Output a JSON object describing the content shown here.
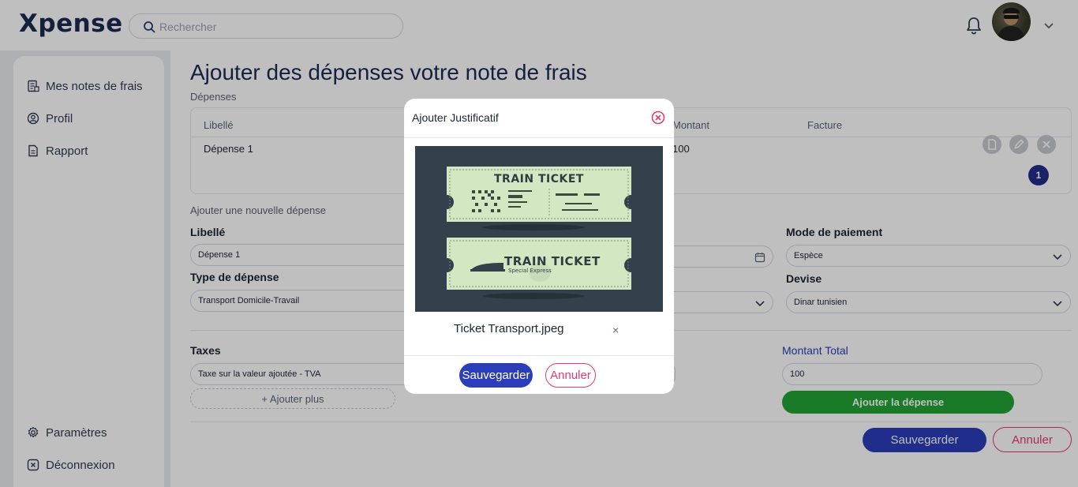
{
  "header": {
    "logo": "Xpense",
    "search_placeholder": "Rechercher"
  },
  "sidebar": {
    "items": [
      {
        "label": "Mes notes de frais",
        "icon": "expense-report-icon"
      },
      {
        "label": "Profil",
        "icon": "user-icon"
      },
      {
        "label": "Rapport",
        "icon": "document-icon"
      }
    ],
    "bottom_items": [
      {
        "label": "Paramètres",
        "icon": "gear-icon"
      },
      {
        "label": "Déconnexion",
        "icon": "logout-icon"
      }
    ]
  },
  "main": {
    "title": "Ajouter des dépenses votre note de frais",
    "section_expenses": "Dépenses",
    "table": {
      "columns": [
        "Libellé",
        "Montant",
        "Facture"
      ],
      "rows": [
        {
          "libelle": "Dépense 1",
          "montant": "100"
        }
      ],
      "page": "1"
    },
    "section_new": "Ajouter une nouvelle dépense",
    "form": {
      "libelle_label": "Libellé",
      "libelle_value": "Dépense 1",
      "type_label": "Type de dépense",
      "type_value": "Transport Domicile-Travail",
      "payment_label": "Mode de paiement",
      "payment_value": "Espèce",
      "currency_label": "Devise",
      "currency_value": "Dinar tunisien",
      "taxes_label": "Taxes",
      "tax_value": "Taxe sur la valeur ajoutée - TVA",
      "add_more": "+ Ajouter plus",
      "total_label": "Montant Total",
      "total_value": "100",
      "add_expense": "Ajouter la dépense"
    },
    "footer": {
      "save": "Sauvegarder",
      "cancel": "Annuler"
    }
  },
  "modal": {
    "title": "Ajouter Justificatif",
    "ticket_title_1": "TRAIN TICKET",
    "ticket_title_2": "TRAIN TICKET",
    "ticket_subtitle": "Special Express",
    "file_name": "Ticket Transport.jpeg",
    "remove": "×",
    "save": "Sauvegarder",
    "cancel": "Annuler"
  },
  "colors": {
    "primary": "#2b3db8",
    "danger": "#e23a72",
    "success": "#22a434",
    "navy": "#1b2a52"
  }
}
